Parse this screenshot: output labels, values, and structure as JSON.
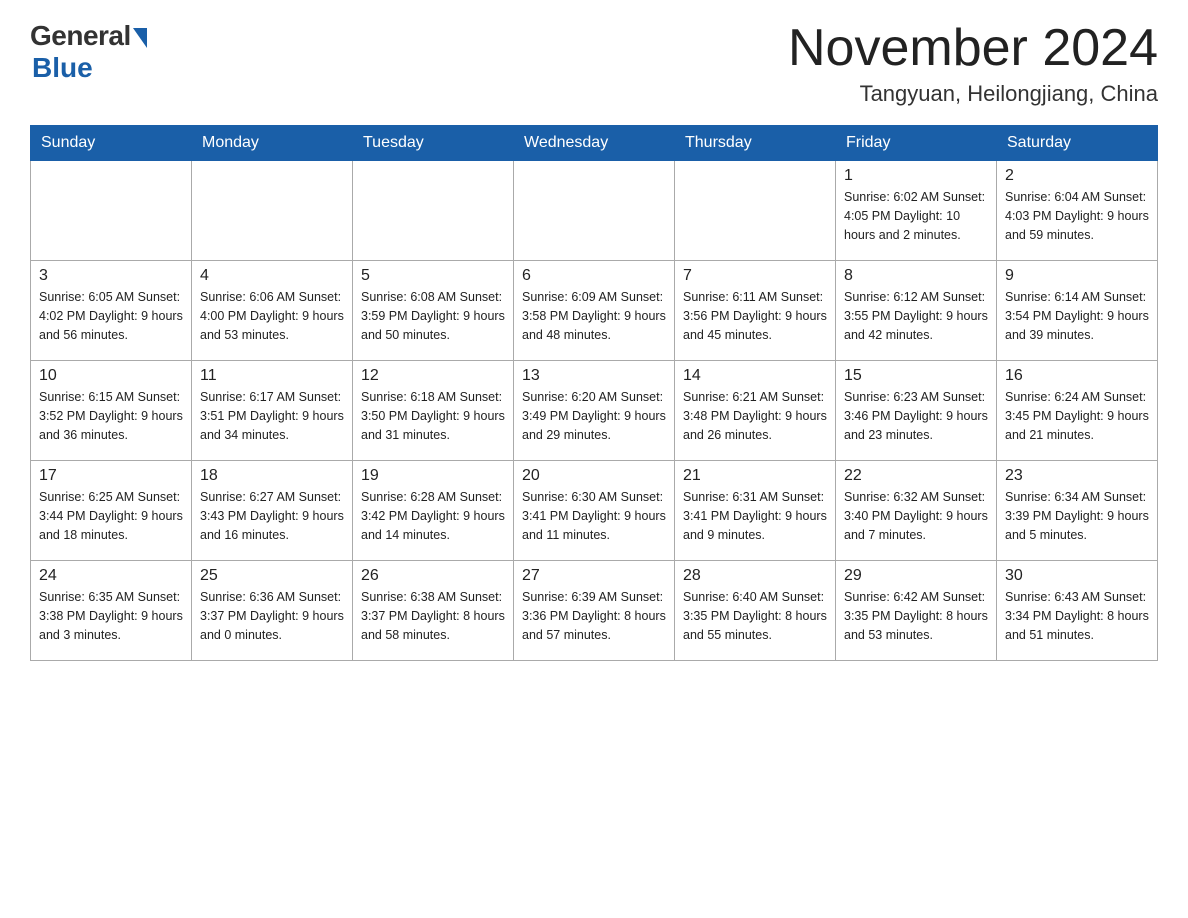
{
  "header": {
    "logo_general": "General",
    "logo_blue": "Blue",
    "month_title": "November 2024",
    "location": "Tangyuan, Heilongjiang, China"
  },
  "weekdays": [
    "Sunday",
    "Monday",
    "Tuesday",
    "Wednesday",
    "Thursday",
    "Friday",
    "Saturday"
  ],
  "weeks": [
    [
      {
        "day": "",
        "info": ""
      },
      {
        "day": "",
        "info": ""
      },
      {
        "day": "",
        "info": ""
      },
      {
        "day": "",
        "info": ""
      },
      {
        "day": "",
        "info": ""
      },
      {
        "day": "1",
        "info": "Sunrise: 6:02 AM\nSunset: 4:05 PM\nDaylight: 10 hours and 2 minutes."
      },
      {
        "day": "2",
        "info": "Sunrise: 6:04 AM\nSunset: 4:03 PM\nDaylight: 9 hours and 59 minutes."
      }
    ],
    [
      {
        "day": "3",
        "info": "Sunrise: 6:05 AM\nSunset: 4:02 PM\nDaylight: 9 hours and 56 minutes."
      },
      {
        "day": "4",
        "info": "Sunrise: 6:06 AM\nSunset: 4:00 PM\nDaylight: 9 hours and 53 minutes."
      },
      {
        "day": "5",
        "info": "Sunrise: 6:08 AM\nSunset: 3:59 PM\nDaylight: 9 hours and 50 minutes."
      },
      {
        "day": "6",
        "info": "Sunrise: 6:09 AM\nSunset: 3:58 PM\nDaylight: 9 hours and 48 minutes."
      },
      {
        "day": "7",
        "info": "Sunrise: 6:11 AM\nSunset: 3:56 PM\nDaylight: 9 hours and 45 minutes."
      },
      {
        "day": "8",
        "info": "Sunrise: 6:12 AM\nSunset: 3:55 PM\nDaylight: 9 hours and 42 minutes."
      },
      {
        "day": "9",
        "info": "Sunrise: 6:14 AM\nSunset: 3:54 PM\nDaylight: 9 hours and 39 minutes."
      }
    ],
    [
      {
        "day": "10",
        "info": "Sunrise: 6:15 AM\nSunset: 3:52 PM\nDaylight: 9 hours and 36 minutes."
      },
      {
        "day": "11",
        "info": "Sunrise: 6:17 AM\nSunset: 3:51 PM\nDaylight: 9 hours and 34 minutes."
      },
      {
        "day": "12",
        "info": "Sunrise: 6:18 AM\nSunset: 3:50 PM\nDaylight: 9 hours and 31 minutes."
      },
      {
        "day": "13",
        "info": "Sunrise: 6:20 AM\nSunset: 3:49 PM\nDaylight: 9 hours and 29 minutes."
      },
      {
        "day": "14",
        "info": "Sunrise: 6:21 AM\nSunset: 3:48 PM\nDaylight: 9 hours and 26 minutes."
      },
      {
        "day": "15",
        "info": "Sunrise: 6:23 AM\nSunset: 3:46 PM\nDaylight: 9 hours and 23 minutes."
      },
      {
        "day": "16",
        "info": "Sunrise: 6:24 AM\nSunset: 3:45 PM\nDaylight: 9 hours and 21 minutes."
      }
    ],
    [
      {
        "day": "17",
        "info": "Sunrise: 6:25 AM\nSunset: 3:44 PM\nDaylight: 9 hours and 18 minutes."
      },
      {
        "day": "18",
        "info": "Sunrise: 6:27 AM\nSunset: 3:43 PM\nDaylight: 9 hours and 16 minutes."
      },
      {
        "day": "19",
        "info": "Sunrise: 6:28 AM\nSunset: 3:42 PM\nDaylight: 9 hours and 14 minutes."
      },
      {
        "day": "20",
        "info": "Sunrise: 6:30 AM\nSunset: 3:41 PM\nDaylight: 9 hours and 11 minutes."
      },
      {
        "day": "21",
        "info": "Sunrise: 6:31 AM\nSunset: 3:41 PM\nDaylight: 9 hours and 9 minutes."
      },
      {
        "day": "22",
        "info": "Sunrise: 6:32 AM\nSunset: 3:40 PM\nDaylight: 9 hours and 7 minutes."
      },
      {
        "day": "23",
        "info": "Sunrise: 6:34 AM\nSunset: 3:39 PM\nDaylight: 9 hours and 5 minutes."
      }
    ],
    [
      {
        "day": "24",
        "info": "Sunrise: 6:35 AM\nSunset: 3:38 PM\nDaylight: 9 hours and 3 minutes."
      },
      {
        "day": "25",
        "info": "Sunrise: 6:36 AM\nSunset: 3:37 PM\nDaylight: 9 hours and 0 minutes."
      },
      {
        "day": "26",
        "info": "Sunrise: 6:38 AM\nSunset: 3:37 PM\nDaylight: 8 hours and 58 minutes."
      },
      {
        "day": "27",
        "info": "Sunrise: 6:39 AM\nSunset: 3:36 PM\nDaylight: 8 hours and 57 minutes."
      },
      {
        "day": "28",
        "info": "Sunrise: 6:40 AM\nSunset: 3:35 PM\nDaylight: 8 hours and 55 minutes."
      },
      {
        "day": "29",
        "info": "Sunrise: 6:42 AM\nSunset: 3:35 PM\nDaylight: 8 hours and 53 minutes."
      },
      {
        "day": "30",
        "info": "Sunrise: 6:43 AM\nSunset: 3:34 PM\nDaylight: 8 hours and 51 minutes."
      }
    ]
  ]
}
